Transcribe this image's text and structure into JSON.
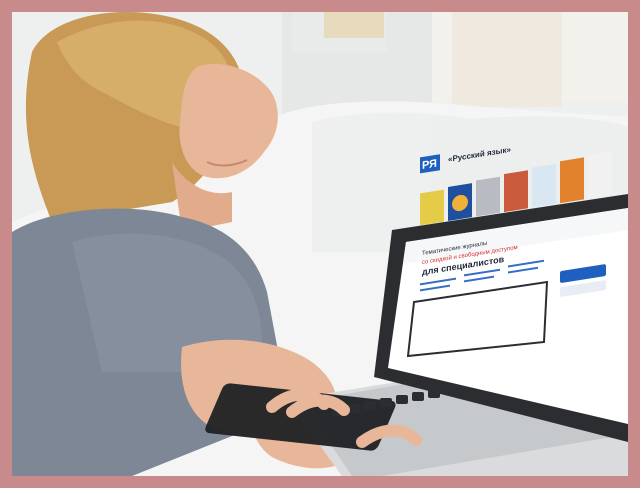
{
  "photo": {
    "description_alt": "",
    "site": {
      "logo_text": "РЯ",
      "name": "«Русский язык»",
      "highlight_line1": "Тематические журналы",
      "highlight_line2": "со скидкой и свободным доступом",
      "highlight_line3": "для специалистов"
    }
  },
  "colors": {
    "border": "#c98a8c",
    "shirt": "#7d8796",
    "hair": "#c99a55",
    "skin": "#e8b79a",
    "laptop": "#2b2d31",
    "accent_blue": "#1f5fbf",
    "accent_red": "#d22b2b"
  }
}
